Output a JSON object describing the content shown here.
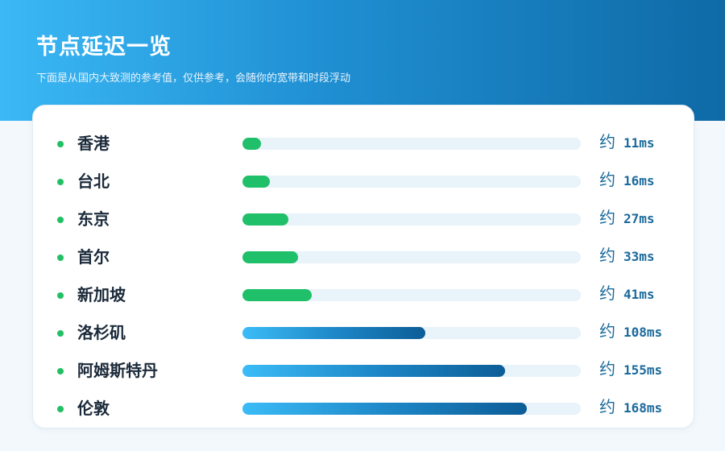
{
  "header": {
    "title": "节点延迟一览",
    "subtitle": "下面是从国内大致测的参考值，仅供参考，会随你的宽带和时段浮动"
  },
  "approx_label": "约",
  "max_ms": 200,
  "nodes": [
    {
      "name": "香港",
      "latency": "11ms",
      "ms": 11,
      "tier": "fast"
    },
    {
      "name": "台北",
      "latency": "16ms",
      "ms": 16,
      "tier": "fast"
    },
    {
      "name": "东京",
      "latency": "27ms",
      "ms": 27,
      "tier": "fast"
    },
    {
      "name": "首尔",
      "latency": "33ms",
      "ms": 33,
      "tier": "fast"
    },
    {
      "name": "新加坡",
      "latency": "41ms",
      "ms": 41,
      "tier": "fast"
    },
    {
      "name": "洛杉矶",
      "latency": "108ms",
      "ms": 108,
      "tier": "slow"
    },
    {
      "name": "阿姆斯特丹",
      "latency": "155ms",
      "ms": 155,
      "tier": "slow"
    },
    {
      "name": "伦敦",
      "latency": "168ms",
      "ms": 168,
      "tier": "slow"
    }
  ],
  "colors": {
    "fast": "#1fc069",
    "slow_start": "#3bbcf7",
    "slow_end": "#0c5d97",
    "dot": "#22c063"
  }
}
